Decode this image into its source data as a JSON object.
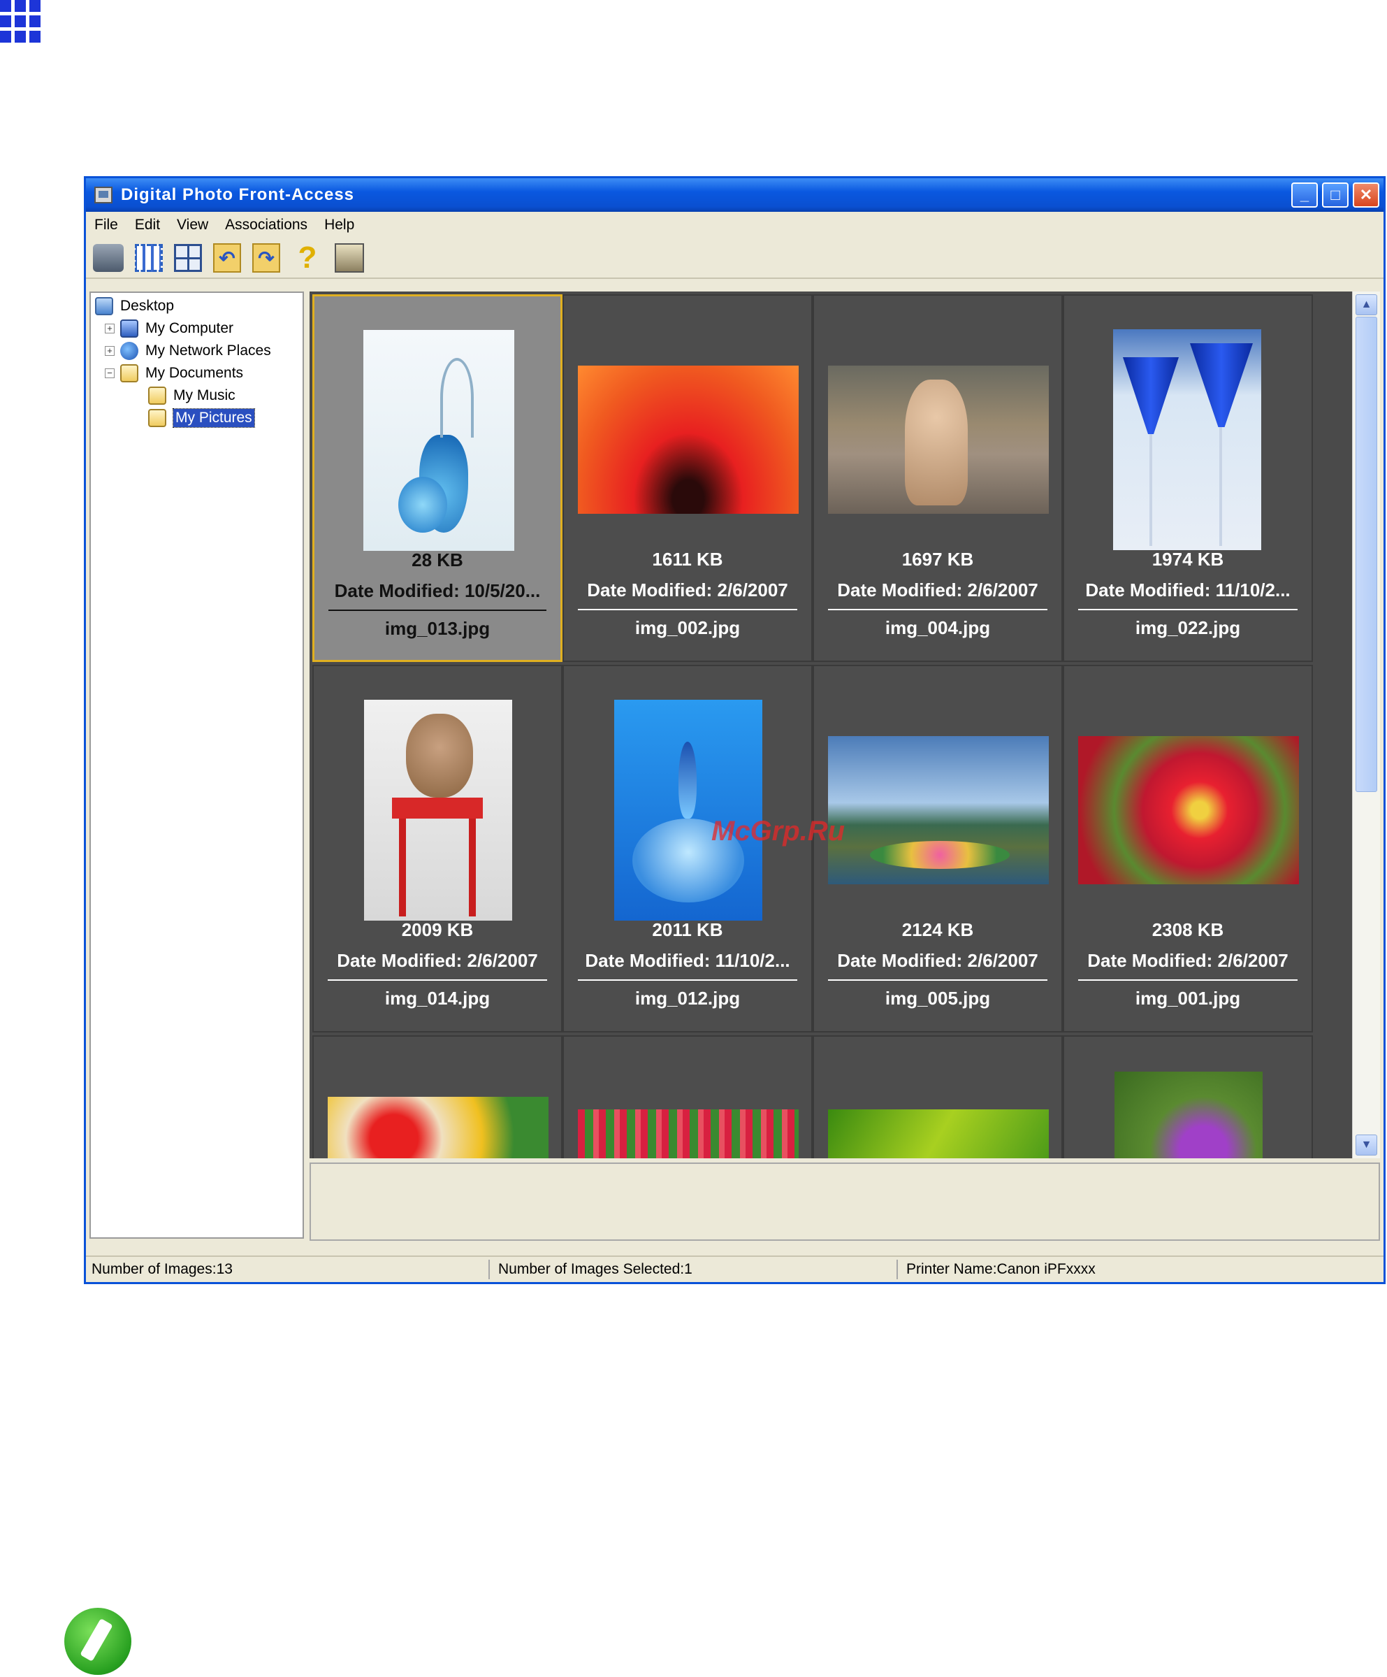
{
  "window": {
    "title": "Digital Photo Front-Access",
    "buttons": {
      "minimize": "_",
      "maximize": "□",
      "close": "✕"
    }
  },
  "menu": [
    "File",
    "Edit",
    "View",
    "Associations",
    "Help"
  ],
  "toolbar": [
    "printer-icon",
    "select-all-icon",
    "thumbnail-view-icon",
    "rotate-left-icon",
    "rotate-right-icon",
    "help-icon",
    "setup-icon"
  ],
  "tree": [
    {
      "label": "Desktop"
    },
    {
      "label": "My Computer"
    },
    {
      "label": "My Network Places"
    },
    {
      "label": "My Documents"
    },
    {
      "label": "My Music"
    },
    {
      "label": "My Pictures"
    }
  ],
  "tiles": [
    {
      "size": "28 KB",
      "date": "Date Modified: 10/5/20...",
      "name": "img_013.jpg",
      "selected": true
    },
    {
      "size": "1611 KB",
      "date": "Date Modified: 2/6/2007",
      "name": "img_002.jpg"
    },
    {
      "size": "1697 KB",
      "date": "Date Modified: 2/6/2007",
      "name": "img_004.jpg"
    },
    {
      "size": "1974 KB",
      "date": "Date Modified: 11/10/2...",
      "name": "img_022.jpg"
    },
    {
      "size": "2009 KB",
      "date": "Date Modified: 2/6/2007",
      "name": "img_014.jpg"
    },
    {
      "size": "2011 KB",
      "date": "Date Modified: 11/10/2...",
      "name": "img_012.jpg"
    },
    {
      "size": "2124 KB",
      "date": "Date Modified: 2/6/2007",
      "name": "img_005.jpg"
    },
    {
      "size": "2308 KB",
      "date": "Date Modified: 2/6/2007",
      "name": "img_001.jpg"
    }
  ],
  "status": {
    "images": "Number of Images:13",
    "selected": "Number of Images Selected:1",
    "printer": "Printer Name:Canon iPFxxxx"
  },
  "watermark": "McGrp.Ru"
}
